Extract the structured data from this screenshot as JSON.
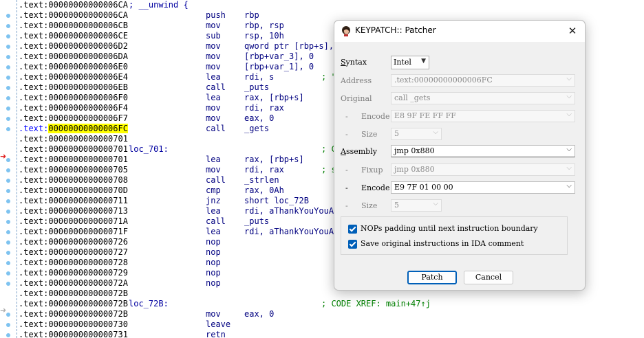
{
  "listing": {
    "rows": [
      {
        "seg": ".text:",
        "addr": "00000000000006CA",
        "label": "; __unwind {",
        "mnem": "",
        "ops": "",
        "comment": ""
      },
      {
        "seg": ".text:",
        "addr": "00000000000006CA",
        "label": "",
        "mnem": "push",
        "ops": "rbp",
        "comment": ""
      },
      {
        "seg": ".text:",
        "addr": "00000000000006CB",
        "label": "",
        "mnem": "mov",
        "ops": "rbp, rsp",
        "comment": ""
      },
      {
        "seg": ".text:",
        "addr": "00000000000006CE",
        "label": "",
        "mnem": "sub",
        "ops": "rsp, 10h",
        "comment": ""
      },
      {
        "seg": ".text:",
        "addr": "00000000000006D2",
        "label": "",
        "mnem": "mov",
        "ops": "qword ptr [rbp+s],",
        "comment": ""
      },
      {
        "seg": ".text:",
        "addr": "00000000000006DA",
        "label": "",
        "mnem": "mov",
        "ops": "[rbp+var_3], 0",
        "comment": ""
      },
      {
        "seg": ".text:",
        "addr": "00000000000006E0",
        "label": "",
        "mnem": "mov",
        "ops": "[rbp+var_1], 0",
        "comment": ""
      },
      {
        "seg": ".text:",
        "addr": "00000000000006E4",
        "label": "",
        "mnem": "lea",
        "ops": "rdi, s",
        "comment": "; \""
      },
      {
        "seg": ".text:",
        "addr": "00000000000006EB",
        "label": "",
        "mnem": "call",
        "ops": "_puts",
        "comment": ""
      },
      {
        "seg": ".text:",
        "addr": "00000000000006F0",
        "label": "",
        "mnem": "lea",
        "ops": "rax, [rbp+s]",
        "comment": ""
      },
      {
        "seg": ".text:",
        "addr": "00000000000006F4",
        "label": "",
        "mnem": "mov",
        "ops": "rdi, rax",
        "comment": ""
      },
      {
        "seg": ".text:",
        "addr": "00000000000006F7",
        "label": "",
        "mnem": "mov",
        "ops": "eax, 0",
        "comment": ""
      },
      {
        "seg": ".text:",
        "addr": "00000000000006FC",
        "label": "",
        "mnem": "call",
        "ops": "_gets",
        "comment": "",
        "current": true
      },
      {
        "seg": ".text:",
        "addr": "0000000000000701",
        "label": "",
        "mnem": "",
        "ops": "",
        "comment": ""
      },
      {
        "seg": ".text:",
        "addr": "0000000000000701",
        "label": "loc_701:",
        "mnem": "",
        "ops": "",
        "comment": "; C"
      },
      {
        "seg": ".text:",
        "addr": "0000000000000701",
        "label": "",
        "mnem": "lea",
        "ops": "rax, [rbp+s]",
        "comment": ""
      },
      {
        "seg": ".text:",
        "addr": "0000000000000705",
        "label": "",
        "mnem": "mov",
        "ops": "rdi, rax",
        "comment": "; s"
      },
      {
        "seg": ".text:",
        "addr": "0000000000000708",
        "label": "",
        "mnem": "call",
        "ops": "_strlen",
        "comment": ""
      },
      {
        "seg": ".text:",
        "addr": "000000000000070D",
        "label": "",
        "mnem": "cmp",
        "ops": "rax, 0Ah",
        "comment": ""
      },
      {
        "seg": ".text:",
        "addr": "0000000000000711",
        "label": "",
        "mnem": "jnz",
        "ops": "short loc_72B",
        "comment": ""
      },
      {
        "seg": ".text:",
        "addr": "0000000000000713",
        "label": "",
        "mnem": "lea",
        "ops": "rdi, aThankYouYouAr",
        "comment": ""
      },
      {
        "seg": ".text:",
        "addr": "000000000000071A",
        "label": "",
        "mnem": "call",
        "ops": "_puts",
        "comment": ""
      },
      {
        "seg": ".text:",
        "addr": "000000000000071F",
        "label": "",
        "mnem": "lea",
        "ops": "rdi, aThankYouYouAr",
        "comment": ""
      },
      {
        "seg": ".text:",
        "addr": "0000000000000726",
        "label": "",
        "mnem": "nop",
        "ops": "",
        "comment": ""
      },
      {
        "seg": ".text:",
        "addr": "0000000000000727",
        "label": "",
        "mnem": "nop",
        "ops": "",
        "comment": ""
      },
      {
        "seg": ".text:",
        "addr": "0000000000000728",
        "label": "",
        "mnem": "nop",
        "ops": "",
        "comment": ""
      },
      {
        "seg": ".text:",
        "addr": "0000000000000729",
        "label": "",
        "mnem": "nop",
        "ops": "",
        "comment": ""
      },
      {
        "seg": ".text:",
        "addr": "000000000000072A",
        "label": "",
        "mnem": "nop",
        "ops": "",
        "comment": ""
      },
      {
        "seg": ".text:",
        "addr": "000000000000072B",
        "label": "",
        "mnem": "",
        "ops": "",
        "comment": ""
      },
      {
        "seg": ".text:",
        "addr": "000000000000072B",
        "label": "loc_72B:",
        "mnem": "",
        "ops": "",
        "comment": "; CODE XREF: main+47↑j"
      },
      {
        "seg": ".text:",
        "addr": "000000000000072B",
        "label": "",
        "mnem": "mov",
        "ops": "eax, 0",
        "comment": ""
      },
      {
        "seg": ".text:",
        "addr": "0000000000000730",
        "label": "",
        "mnem": "leave",
        "ops": "",
        "comment": ""
      },
      {
        "seg": ".text:",
        "addr": "0000000000000731",
        "label": "",
        "mnem": "retn",
        "ops": "",
        "comment": ""
      }
    ]
  },
  "dialog": {
    "title": "KEYPATCH:: Patcher",
    "syntax": {
      "label": "Syntax",
      "value": "Intel"
    },
    "address": {
      "label": "Address",
      "value": ".text:00000000000006FC"
    },
    "original": {
      "label": "Original",
      "value": "call _gets"
    },
    "original_encode": {
      "label": "Encode",
      "value": "E8 9F FE FF FF"
    },
    "original_size": {
      "label": "Size",
      "value": "5"
    },
    "assembly": {
      "label": "Assembly",
      "value": "jmp 0x880"
    },
    "fixup": {
      "label": "Fixup",
      "value": "jmp 0x880"
    },
    "encode": {
      "label": "Encode",
      "value": "E9 7F 01 00 00"
    },
    "size": {
      "label": "Size",
      "value": "5"
    },
    "dash": "-",
    "options": {
      "nops_label": "NOPs padding until next instruction boundary",
      "save_label": "Save original instructions in IDA comment"
    },
    "patch_label": "Patch",
    "cancel_label": "Cancel",
    "close_glyph": "✕"
  },
  "colors": {
    "accent": "#005fb8",
    "highlight": "#ffff00",
    "disassembly_text": "#000080",
    "comment": "#008000"
  }
}
